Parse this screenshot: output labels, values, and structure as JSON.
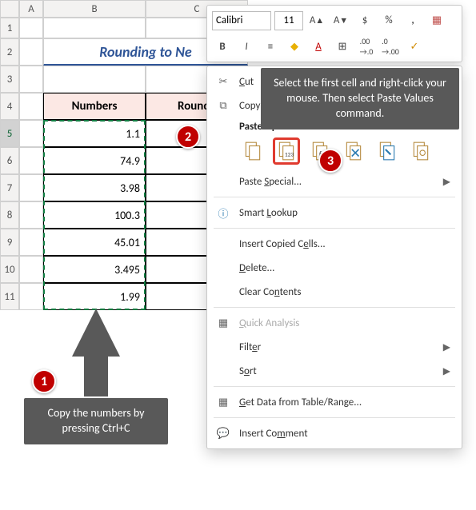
{
  "columns": [
    "A",
    "B",
    "C"
  ],
  "rows": [
    "1",
    "2",
    "3",
    "4",
    "5",
    "6",
    "7",
    "8",
    "9",
    "10",
    "11"
  ],
  "title": "Rounding to Ne",
  "headers": {
    "b": "Numbers",
    "c": "Rounde"
  },
  "data": {
    "b5": "1.1",
    "b6": "74.9",
    "b7": "3.98",
    "b8": "100.3",
    "b9": "45.01",
    "b10": "3.495",
    "b11": "1.99"
  },
  "minitoolbar": {
    "font": "Calibri",
    "size": "11",
    "icons": [
      "A+",
      "A−",
      "A",
      "$",
      "%",
      ",",
      "≡"
    ],
    "row2": [
      "B",
      "I",
      "≡",
      "◆",
      "A",
      "⊞",
      ".00→.0",
      ".0→.00",
      "✓"
    ]
  },
  "context": {
    "cut": "Cut",
    "copy": "Copy",
    "paste_options": "Paste Options:",
    "paste_special": "Paste Special...",
    "smart_lookup": "Smart Lookup",
    "insert": "Insert Copied Cells...",
    "delete": "Delete...",
    "clear": "Clear Contents",
    "quick": "Quick Analysis",
    "filter": "Filter",
    "sort": "Sort",
    "getdata": "Get Data from Table/Range...",
    "comment": "Insert Comment"
  },
  "tooltip": "Select the first cell and right-click your mouse. Then select Paste Values command.",
  "callout1": "Copy the numbers by pressing Ctrl+C",
  "badges": {
    "one": "1",
    "two": "2",
    "three": "3"
  }
}
